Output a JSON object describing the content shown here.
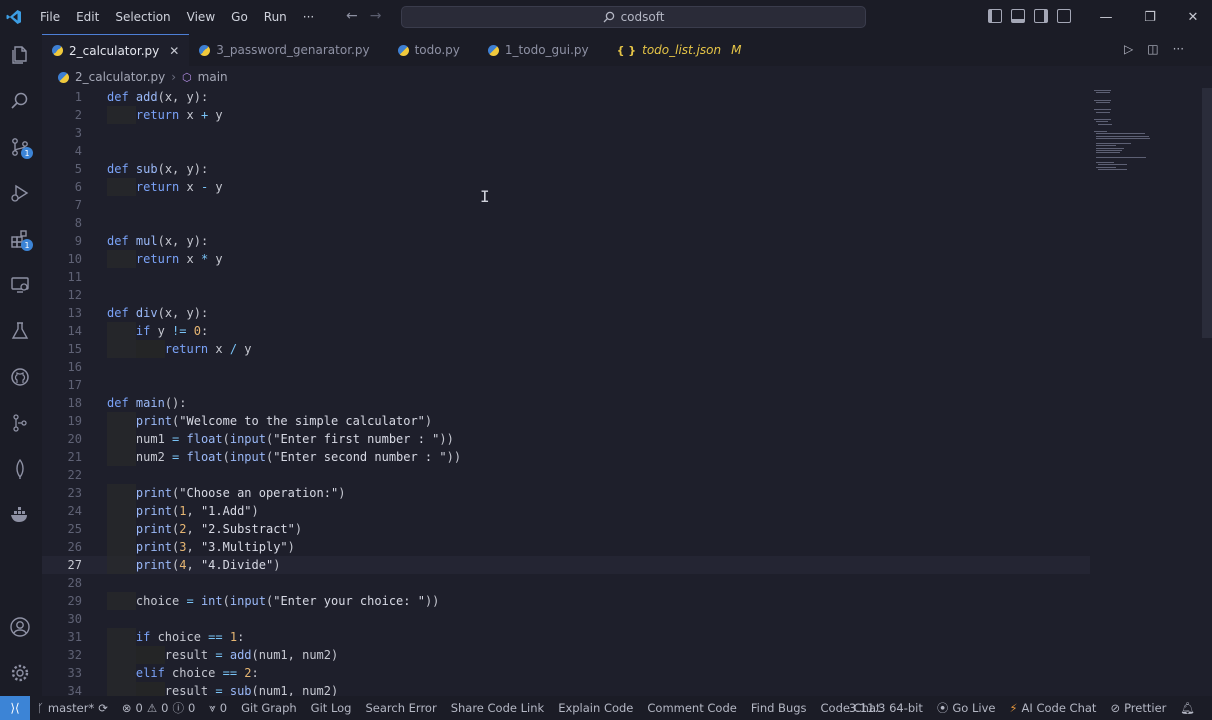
{
  "titlebar": {
    "menu": [
      "File",
      "Edit",
      "Selection",
      "View",
      "Go",
      "Run",
      "···"
    ],
    "search_text": "codsoft"
  },
  "tabs": [
    {
      "label": "2_calculator.py",
      "type": "py",
      "active": true
    },
    {
      "label": "3_password_genarator.py",
      "type": "py"
    },
    {
      "label": "todo.py",
      "type": "py"
    },
    {
      "label": "1_todo_gui.py",
      "type": "py"
    },
    {
      "label": "todo_list.json",
      "type": "json",
      "modified": "M"
    }
  ],
  "breadcrumb": {
    "file": "2_calculator.py",
    "symbol": "main"
  },
  "activity_badges": {
    "scm": "1",
    "extensions": "1"
  },
  "editor": {
    "current_line": 27,
    "lines": [
      "def add(x, y):",
      "    return x + y",
      "",
      "",
      "def sub(x, y):",
      "    return x - y",
      "",
      "",
      "def mul(x, y):",
      "    return x * y",
      "",
      "",
      "def div(x, y):",
      "    if y != 0:",
      "        return x / y",
      "",
      "",
      "def main():",
      "    print(\"Welcome to the simple calculator\")",
      "    num1 = float(input(\"Enter first number : \"))",
      "    num2 = float(input(\"Enter second number : \"))",
      "",
      "    print(\"Choose an operation:\")",
      "    print(1, \"1.Add\")",
      "    print(2, \"2.Substract\")",
      "    print(3, \"3.Multiply\")",
      "    print(4, \"4.Divide\")",
      "",
      "    choice = int(input(\"Enter your choice: \"))",
      "",
      "    if choice == 1:",
      "        result = add(num1, num2)",
      "    elif choice == 2:",
      "        result = sub(num1, num2)"
    ]
  },
  "statusbar": {
    "branch": "master*",
    "errors": "0",
    "warnings": "0",
    "info": "0",
    "ports": "0",
    "items": [
      "Git Graph",
      "Git Log",
      "Search Error",
      "Share Code Link",
      "Explain Code",
      "Comment Code",
      "Find Bugs",
      "Code Chat"
    ],
    "python": "3.11.3 64-bit",
    "go_live": "Go Live",
    "ai_chat": "AI Code Chat",
    "prettier": "Prettier"
  },
  "colors": {
    "accent": "#3c84d6",
    "background": "#1e1f2b",
    "keyword": "#7aa2f7"
  }
}
